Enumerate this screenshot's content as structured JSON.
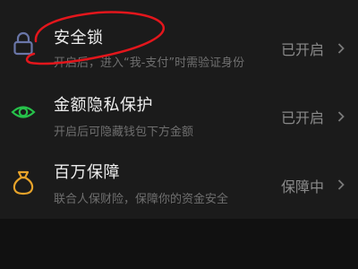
{
  "colors": {
    "lock_icon": "#6a76a8",
    "eye_icon": "#26c24a",
    "bag_icon": "#e7a32a",
    "annotation": "#e3161c"
  },
  "settings": {
    "items": [
      {
        "icon": "lock-icon",
        "title": "安全锁",
        "subtitle": "开启后，进入“我-支付”时需验证身份",
        "status": "已开启"
      },
      {
        "icon": "eye-icon",
        "title": "金额隐私保护",
        "subtitle": "开启后可隐藏钱包下方金额",
        "status": "已开启"
      },
      {
        "icon": "money-bag-icon",
        "title": "百万保障",
        "subtitle": "联合人保财险，保障你的资金安全",
        "status": "保障中"
      }
    ]
  }
}
